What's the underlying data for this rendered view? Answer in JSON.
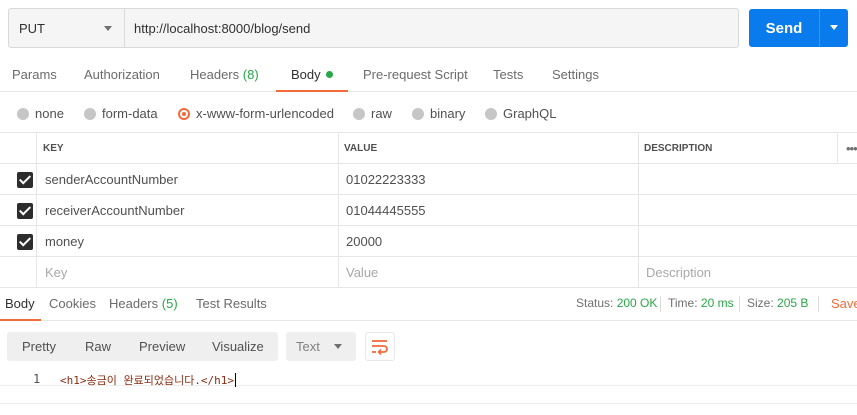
{
  "request": {
    "method": "PUT",
    "url": "http://localhost:8000/blog/send",
    "send_label": "Send"
  },
  "request_tabs": [
    {
      "label": "Params"
    },
    {
      "label": "Authorization"
    },
    {
      "label": "Headers",
      "count": "(8)"
    },
    {
      "label": "Body",
      "active": true
    },
    {
      "label": "Pre-request Script"
    },
    {
      "label": "Tests"
    },
    {
      "label": "Settings"
    }
  ],
  "body_types": [
    {
      "label": "none",
      "selected": false
    },
    {
      "label": "form-data",
      "selected": false
    },
    {
      "label": "x-www-form-urlencoded",
      "selected": true
    },
    {
      "label": "raw",
      "selected": false
    },
    {
      "label": "binary",
      "selected": false
    },
    {
      "label": "GraphQL",
      "selected": false
    }
  ],
  "table": {
    "headers": {
      "key": "KEY",
      "value": "VALUE",
      "description": "DESCRIPTION"
    },
    "more_label": "•••",
    "rows": [
      {
        "checked": true,
        "key": "senderAccountNumber",
        "value": "01022223333",
        "description": ""
      },
      {
        "checked": true,
        "key": "receiverAccountNumber",
        "value": "01044445555",
        "description": ""
      },
      {
        "checked": true,
        "key": "money",
        "value": "20000",
        "description": ""
      }
    ],
    "placeholders": {
      "key": "Key",
      "value": "Value",
      "description": "Description"
    }
  },
  "response_tabs": [
    {
      "label": "Body",
      "active": true
    },
    {
      "label": "Cookies"
    },
    {
      "label": "Headers",
      "count": "(5)"
    },
    {
      "label": "Test Results"
    }
  ],
  "response_status": {
    "status_label": "Status:",
    "status": "200 OK",
    "time_label": "Time:",
    "time": "20 ms",
    "size_label": "Size:",
    "size": "205 B",
    "save_label": "Save"
  },
  "view_modes": [
    "Pretty",
    "Raw",
    "Preview",
    "Visualize"
  ],
  "format_select": "Text",
  "response_body": {
    "line_number": "1",
    "content": "<h1>송금이 완료되었습니다.</h1>"
  },
  "colors": {
    "accent": "#f26b3a",
    "send_button": "#097bed",
    "success": "#27a846"
  },
  "icons": {
    "method_dropdown": "chevron-down-icon",
    "send_dropdown": "chevron-down-icon",
    "wrap": "wrap-lines-icon",
    "checkbox": "checkbox-checked-icon"
  }
}
